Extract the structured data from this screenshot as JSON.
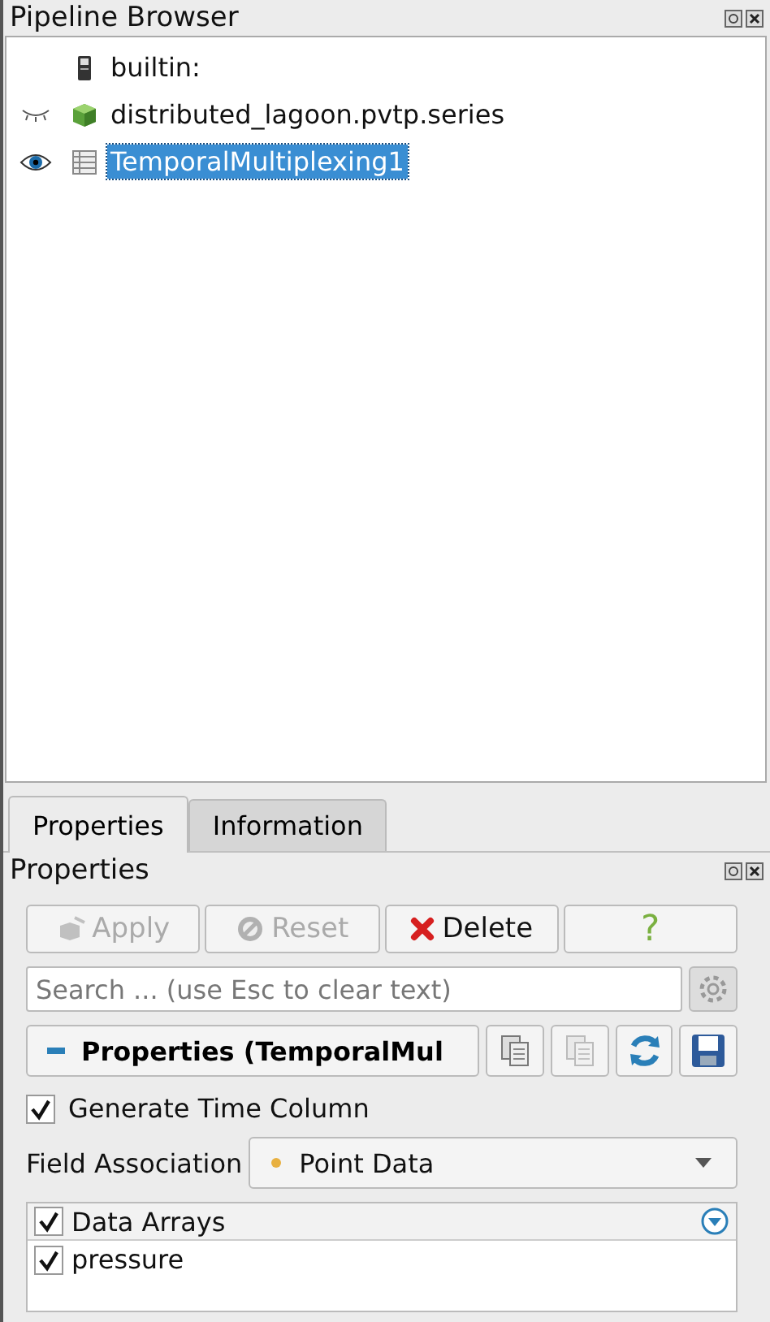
{
  "pipeline_browser": {
    "title": "Pipeline Browser",
    "items": [
      {
        "label": "builtin:",
        "kind": "server",
        "selected": false
      },
      {
        "label": "distributed_lagoon.pvtp.series",
        "kind": "source",
        "visible": false,
        "selected": false
      },
      {
        "label": "TemporalMultiplexing1",
        "kind": "filter",
        "visible": true,
        "selected": true
      }
    ]
  },
  "tabs": [
    {
      "label": "Properties",
      "selected": true
    },
    {
      "label": "Information",
      "selected": false
    }
  ],
  "properties": {
    "title": "Properties",
    "buttons": [
      {
        "label": "Apply",
        "kind": "apply",
        "disabled": true
      },
      {
        "label": "Reset",
        "kind": "reset",
        "disabled": true
      },
      {
        "label": "Delete",
        "kind": "delete",
        "disabled": false
      },
      {
        "label": "?",
        "kind": "help",
        "disabled": false
      }
    ],
    "search": {
      "placeholder": "Search ... (use Esc to clear text)"
    },
    "section": {
      "label": "Properties (TemporalMul",
      "expanded": true
    },
    "tool_buttons": [
      {
        "kind": "copy",
        "disabled": false
      },
      {
        "kind": "paste",
        "disabled": true
      },
      {
        "kind": "refresh",
        "disabled": false
      },
      {
        "kind": "save",
        "disabled": false
      }
    ],
    "generate_time_column": {
      "label": "Generate Time Column",
      "checked": true
    },
    "field_association": {
      "label": "Field Association",
      "value": "Point Data"
    },
    "data_arrays": {
      "header": {
        "label": "Data Arrays",
        "checked": true
      },
      "rows": [
        {
          "label": "pressure",
          "checked": true
        }
      ]
    }
  }
}
